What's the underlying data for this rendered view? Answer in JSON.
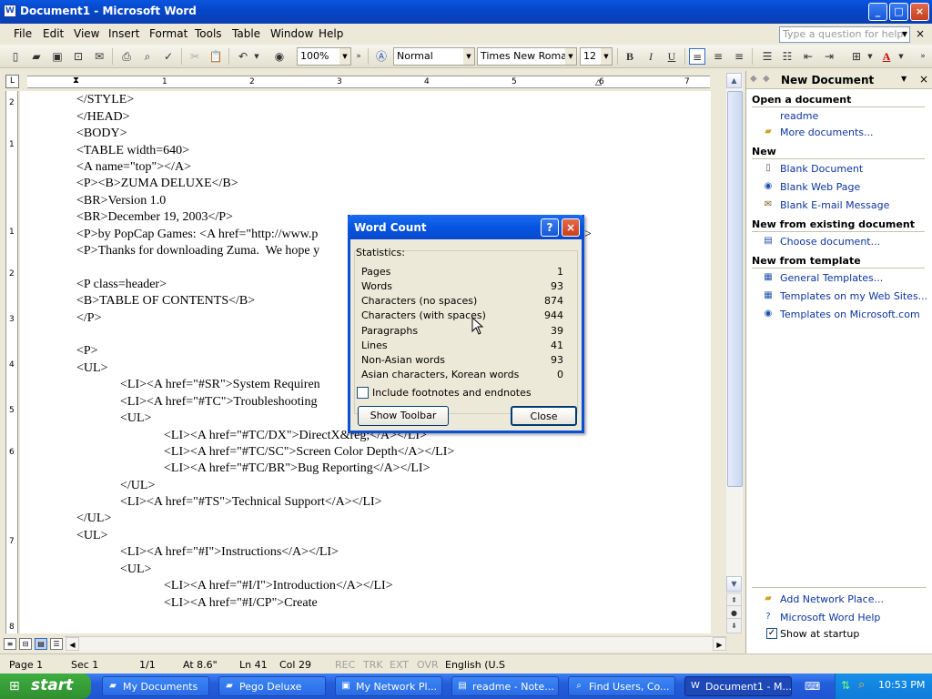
{
  "window": {
    "title": "Document1 - Microsoft Word",
    "min": "_",
    "max": "□",
    "close": "×"
  },
  "menu": [
    "File",
    "Edit",
    "View",
    "Insert",
    "Format",
    "Tools",
    "Table",
    "Window",
    "Help"
  ],
  "help_box": {
    "placeholder": "Type a question for help"
  },
  "toolbar": {
    "zoom": "100%",
    "style": "Normal",
    "font": "Times New Roman",
    "size": "12",
    "bold": "B",
    "italic": "I",
    "underline": "U"
  },
  "ruler": {
    "numbers": [
      "1",
      "2",
      "3",
      "4",
      "5",
      "6",
      "7"
    ]
  },
  "vruler": {
    "numbers": [
      "2",
      "1",
      "1",
      "2",
      "3",
      "4",
      "5",
      "6",
      "7",
      "8"
    ]
  },
  "document": {
    "lines": [
      "</STYLE>",
      "</HEAD>",
      "<BODY>",
      "<TABLE width=640>",
      "<A name=\"top\"></A>",
      "<P><B>ZUMA DELUXE</B>",
      "<BR>Version 1.0",
      "<BR>December 19, 2003</P>",
      "<P>by PopCap Games: <A href=\"http://www.p",
      "<P>Thanks for downloading Zuma.  We hope y",
      "",
      "<P class=header>",
      "<B>TABLE OF CONTENTS</B>",
      "</P>",
      "",
      "<P>",
      "<UL>",
      "<LI><A href=\"#SR\">System Requiren",
      "<LI><A href=\"#TC\">Troubleshooting",
      "<UL>",
      "<LI><A href=\"#TC/DX\">DirectX&reg;</A></LI>",
      "<LI><A href=\"#TC/SC\">Screen Color Depth</A></LI>",
      "<LI><A href=\"#TC/BR\">Bug Reporting</A></LI>",
      "</UL>",
      "<LI><A href=\"#TS\">Technical Support</A></LI>",
      "</UL>",
      "<UL>",
      "<LI><A href=\"#I\">Instructions</A></LI>",
      "<UL>",
      "<LI><A href=\"#I/I\">Introduction</A></LI>",
      "<LI><A href=\"#I/CP\">Create"
    ],
    "right_fragment": ">"
  },
  "task_pane": {
    "title": "New Document",
    "open_section": "Open a document",
    "open_items": [
      "readme",
      "More documents..."
    ],
    "new_section": "New",
    "new_items": [
      "Blank Document",
      "Blank Web Page",
      "Blank E-mail Message"
    ],
    "existing_section": "New from existing document",
    "existing_items": [
      "Choose document..."
    ],
    "template_section": "New from template",
    "template_items": [
      "General Templates...",
      "Templates on my Web Sites...",
      "Templates on Microsoft.com"
    ],
    "bottom_items": [
      "Add Network Place...",
      "Microsoft Word Help"
    ],
    "show_at_startup": "Show at startup",
    "show_at_startup_checked": true
  },
  "status": {
    "page": "Page 1",
    "sec": "Sec 1",
    "pages": "1/1",
    "at": "At 8.6\"",
    "ln": "Ln 41",
    "col": "Col 29",
    "rec": "REC",
    "trk": "TRK",
    "ext": "EXT",
    "ovr": "OVR",
    "lang": "English (U.S"
  },
  "dialog": {
    "title": "Word Count",
    "help": "?",
    "close_x": "×",
    "group_label": "Statistics:",
    "stats": [
      {
        "label": "Pages",
        "value": "1"
      },
      {
        "label": "Words",
        "value": "93"
      },
      {
        "label": "Characters (no spaces)",
        "value": "874"
      },
      {
        "label": "Characters (with spaces)",
        "value": "944"
      },
      {
        "label": "Paragraphs",
        "value": "39"
      },
      {
        "label": "Lines",
        "value": "41"
      },
      {
        "label": "Non-Asian words",
        "value": "93"
      },
      {
        "label": "Asian characters, Korean words",
        "value": "0"
      }
    ],
    "include_footnotes": "Include footnotes and endnotes",
    "include_footnotes_checked": false,
    "show_toolbar": "Show Toolbar",
    "close": "Close"
  },
  "taskbar": {
    "start": "start",
    "tasks": [
      "My Documents",
      "Pego Deluxe",
      "My Network Pl...",
      "readme - Note...",
      "Find Users, Co...",
      "Document1 - M..."
    ],
    "active_task": 5,
    "clock": "10:53 PM"
  },
  "colors": {
    "title_blue": "#0a55e0",
    "link_blue": "#0c34a0",
    "taskbar_blue": "#245ddb",
    "start_green": "#3fae3f"
  }
}
